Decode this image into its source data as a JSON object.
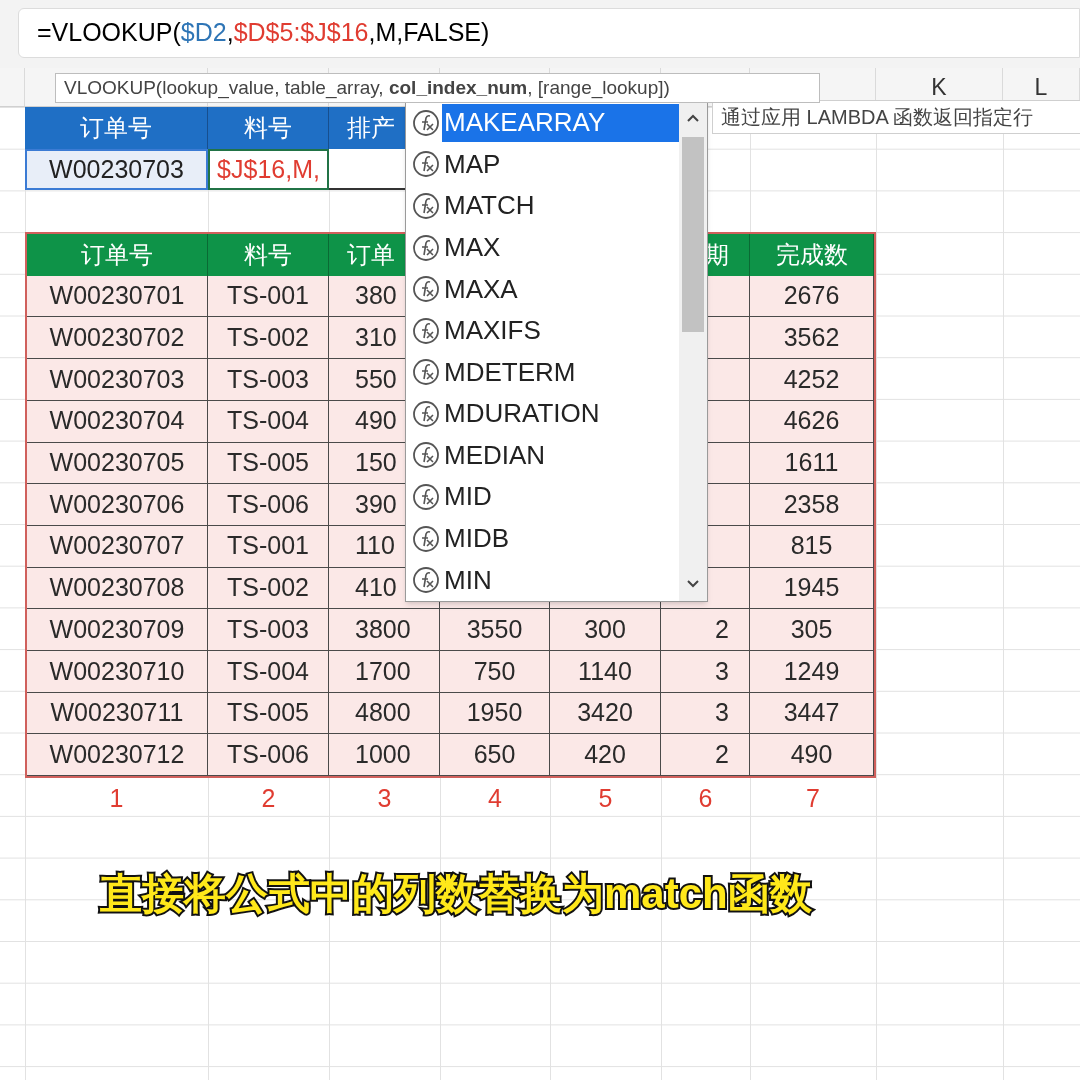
{
  "formula_bar": {
    "segments": [
      {
        "text": "=VLOOKUP(",
        "color": "#000000"
      },
      {
        "text": "$D2",
        "color": "#2e75b6"
      },
      {
        "text": ",",
        "color": "#000000"
      },
      {
        "text": "$D$5:$J$16",
        "color": "#e03c31"
      },
      {
        "text": ",M,FALSE)",
        "color": "#000000"
      }
    ]
  },
  "signature_tip": "VLOOKUP(lookup_value, table_array, **col_index_num**, [range_lookup])",
  "column_headers": [
    "K",
    "L"
  ],
  "lookup_table": {
    "columns": [
      "订单号",
      "料号",
      "排产"
    ],
    "cells": [
      {
        "text": "W00230703",
        "referenced": true,
        "editing": false
      },
      {
        "text": "$J$16,M,",
        "referenced": false,
        "editing": true
      }
    ]
  },
  "data_table": {
    "columns": [
      "订单号",
      "料号",
      "订单",
      null,
      null,
      "期",
      "完成数"
    ],
    "rows": [
      [
        "W00230701",
        "TS-001",
        "380",
        null,
        null,
        null,
        "2676"
      ],
      [
        "W00230702",
        "TS-002",
        "310",
        null,
        null,
        null,
        "3562"
      ],
      [
        "W00230703",
        "TS-003",
        "550",
        null,
        null,
        null,
        "4252"
      ],
      [
        "W00230704",
        "TS-004",
        "490",
        null,
        null,
        null,
        "4626"
      ],
      [
        "W00230705",
        "TS-005",
        "150",
        null,
        null,
        null,
        "1611"
      ],
      [
        "W00230706",
        "TS-006",
        "390",
        null,
        null,
        null,
        "2358"
      ],
      [
        "W00230707",
        "TS-001",
        "110",
        null,
        null,
        null,
        "815"
      ],
      [
        "W00230708",
        "TS-002",
        "410",
        null,
        null,
        null,
        "1945"
      ],
      [
        "W00230709",
        "TS-003",
        "3800",
        "3550",
        "300",
        "2",
        "305"
      ],
      [
        "W00230710",
        "TS-004",
        "1700",
        "750",
        "1140",
        "3",
        "1249"
      ],
      [
        "W00230711",
        "TS-005",
        "4800",
        "1950",
        "3420",
        "3",
        "3447"
      ],
      [
        "W00230712",
        "TS-006",
        "1000",
        "650",
        "420",
        "2",
        "490"
      ]
    ],
    "column_numbers": [
      "1",
      "2",
      "3",
      "4",
      "5",
      "6",
      "7"
    ]
  },
  "autocomplete": {
    "items": [
      {
        "label": "MAKEARRAY",
        "selected": true
      },
      {
        "label": "MAP",
        "selected": false
      },
      {
        "label": "MATCH",
        "selected": false
      },
      {
        "label": "MAX",
        "selected": false
      },
      {
        "label": "MAXA",
        "selected": false
      },
      {
        "label": "MAXIFS",
        "selected": false
      },
      {
        "label": "MDETERM",
        "selected": false
      },
      {
        "label": "MDURATION",
        "selected": false
      },
      {
        "label": "MEDIAN",
        "selected": false
      },
      {
        "label": "MID",
        "selected": false
      },
      {
        "label": "MIDB",
        "selected": false
      },
      {
        "label": "MIN",
        "selected": false
      }
    ],
    "description": "通过应用 LAMBDA 函数返回指定行"
  },
  "caption": "直接将公式中的列数替换为match函数"
}
